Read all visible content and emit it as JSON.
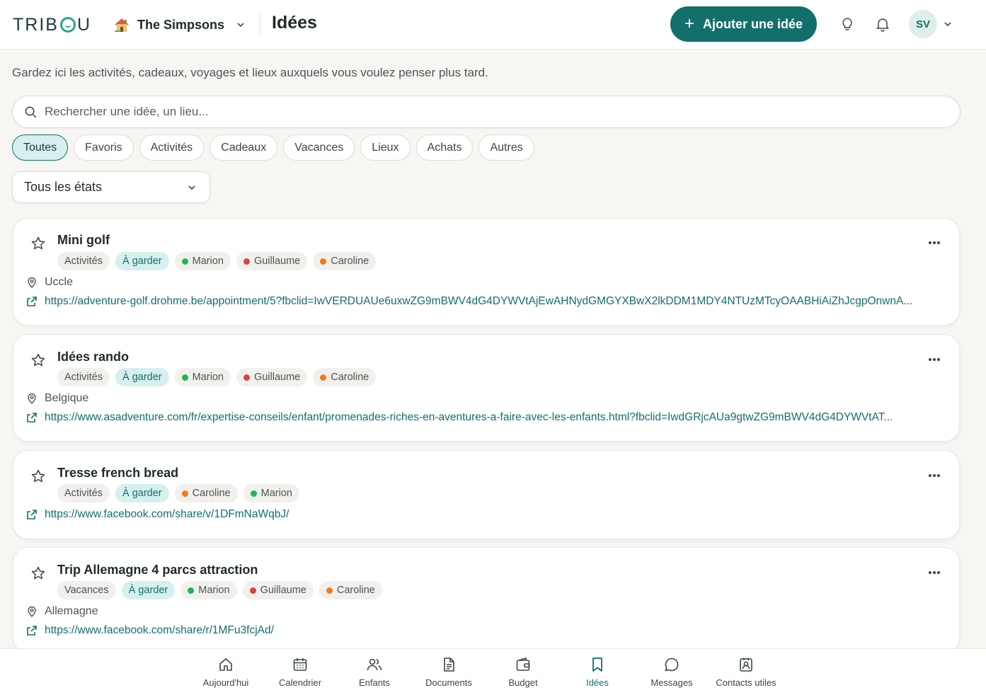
{
  "header": {
    "logo": {
      "pre": "TRIB",
      "post": "U"
    },
    "family_name": "The Simpsons",
    "page_title": "Idées",
    "add_button": "Ajouter une idée",
    "avatar_initials": "SV"
  },
  "subtitle": "Gardez ici les activités, cadeaux, voyages et lieux auxquels vous voulez penser plus tard.",
  "search": {
    "placeholder": "Rechercher une idée, un lieu..."
  },
  "filters": [
    "Toutes",
    "Favoris",
    "Activités",
    "Cadeaux",
    "Vacances",
    "Lieux",
    "Achats",
    "Autres"
  ],
  "active_filter": "Toutes",
  "state_filter": "Tous les états",
  "colors": {
    "accent": "#136f6a",
    "marion": "#22b45a",
    "guillaume": "#e03e3e",
    "caroline": "#f07a1a"
  },
  "ideas": [
    {
      "title": "Mini golf",
      "category": "Activités",
      "status": "À garder",
      "people": [
        {
          "name": "Marion",
          "color": "#22b45a"
        },
        {
          "name": "Guillaume",
          "color": "#e03e3e"
        },
        {
          "name": "Caroline",
          "color": "#f07a1a"
        }
      ],
      "location": "Uccle",
      "link": "https://adventure-golf.drohme.be/appointment/5?fbclid=IwVERDUAUe6uxwZG9mBWV4dG4DYWVtAjEwAHNydGMGYXBwX2lkDDM1MDY4NTUzMTcyOAABHiAiZhJcgpOnwnA..."
    },
    {
      "title": "Idées rando",
      "category": "Activités",
      "status": "À garder",
      "people": [
        {
          "name": "Marion",
          "color": "#22b45a"
        },
        {
          "name": "Guillaume",
          "color": "#e03e3e"
        },
        {
          "name": "Caroline",
          "color": "#f07a1a"
        }
      ],
      "location": "Belgique",
      "link": "https://www.asadventure.com/fr/expertise-conseils/enfant/promenades-riches-en-aventures-a-faire-avec-les-enfants.html?fbclid=IwdGRjcAUa9gtwZG9mBWV4dG4DYWVtAT..."
    },
    {
      "title": "Tresse french bread",
      "category": "Activités",
      "status": "À garder",
      "people": [
        {
          "name": "Caroline",
          "color": "#f07a1a"
        },
        {
          "name": "Marion",
          "color": "#22b45a"
        }
      ],
      "location": "",
      "link": "https://www.facebook.com/share/v/1DFmNaWqbJ/"
    },
    {
      "title": "Trip Allemagne 4 parcs attraction",
      "category": "Vacances",
      "status": "À garder",
      "people": [
        {
          "name": "Marion",
          "color": "#22b45a"
        },
        {
          "name": "Guillaume",
          "color": "#e03e3e"
        },
        {
          "name": "Caroline",
          "color": "#f07a1a"
        }
      ],
      "location": "Allemagne",
      "link": "https://www.facebook.com/share/r/1MFu3fcjAd/"
    }
  ],
  "nav": [
    {
      "label": "Aujourd'hui",
      "icon": "home-icon"
    },
    {
      "label": "Calendrier",
      "icon": "calendar-icon"
    },
    {
      "label": "Enfants",
      "icon": "users-icon"
    },
    {
      "label": "Documents",
      "icon": "document-icon"
    },
    {
      "label": "Budget",
      "icon": "wallet-icon"
    },
    {
      "label": "Idées",
      "icon": "bookmark-icon",
      "active": true
    },
    {
      "label": "Messages",
      "icon": "message-icon"
    },
    {
      "label": "Contacts utiles",
      "icon": "contact-icon"
    }
  ]
}
